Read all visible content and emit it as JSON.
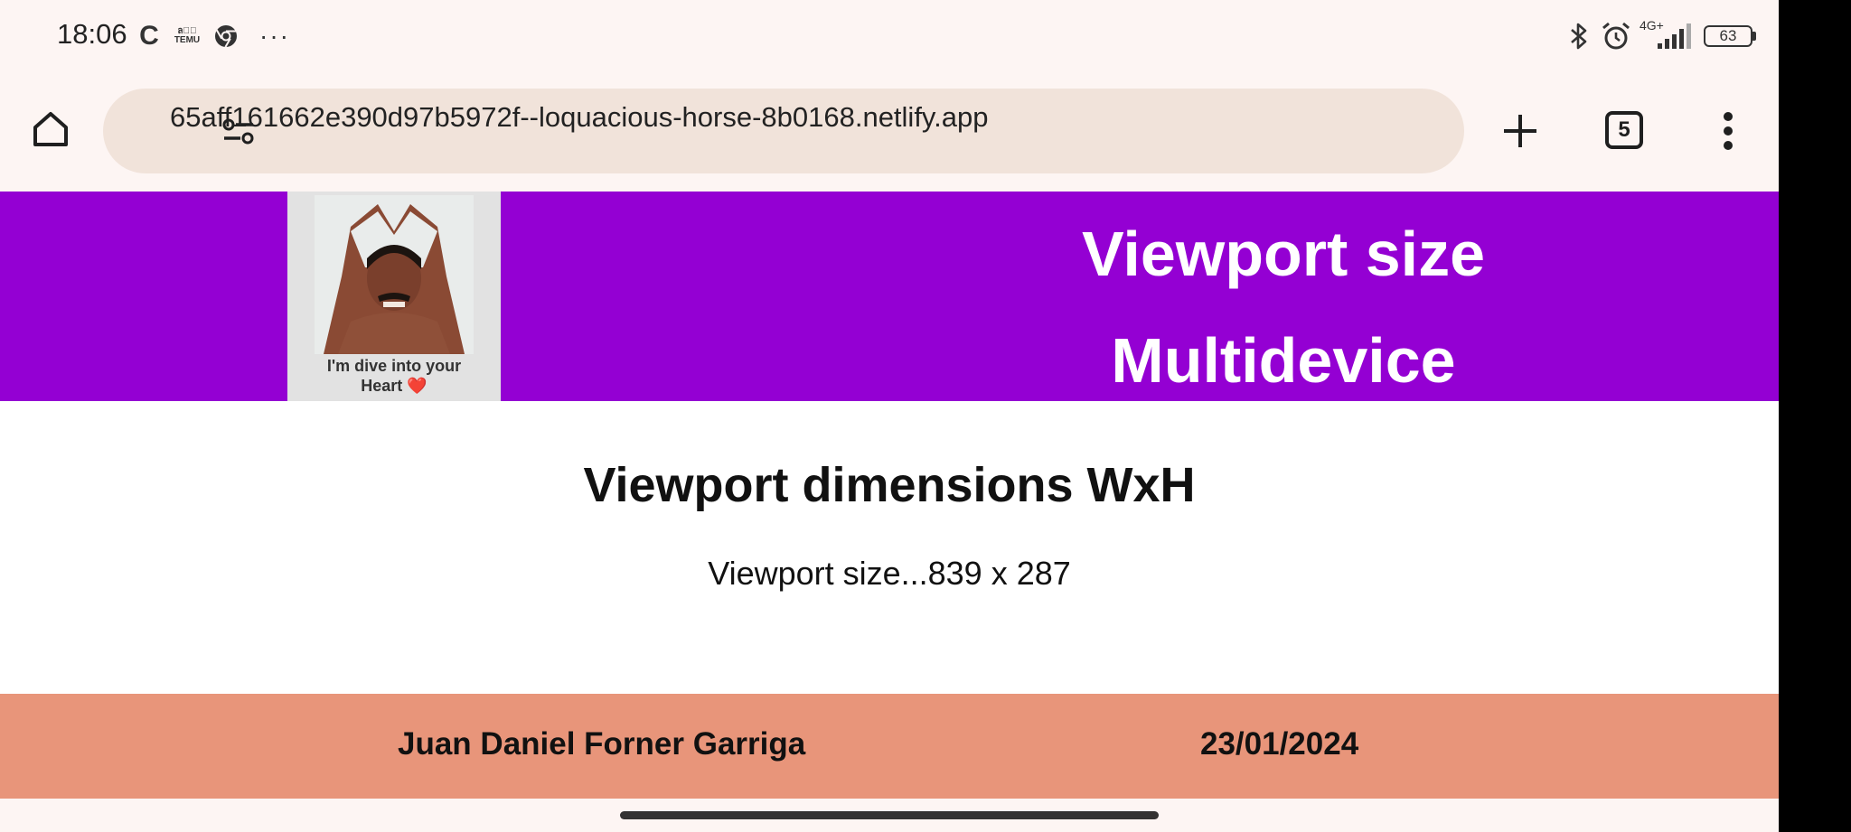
{
  "status_bar": {
    "time": "18:06",
    "c_icon_glyph": "C",
    "temu_top": "ล≋ํ",
    "temu_bottom": "TEMU",
    "more_dots": "···",
    "signal_label": "4G+",
    "battery_level": "63",
    "icons": [
      "c-icon",
      "temu-icon",
      "chrome-icon",
      "more-icon",
      "bluetooth-icon",
      "alarm-icon",
      "signal-icon",
      "battery-icon"
    ]
  },
  "browser": {
    "url": "65aff161662e390d97b5972f--loquacious-horse-8b0168.netlify.app",
    "tab_count": "5",
    "icons": [
      "home-icon",
      "site-settings-icon",
      "plus-icon",
      "tabs-icon",
      "more-vert-icon"
    ]
  },
  "page": {
    "logo_caption_line1": "I'm dive into your",
    "logo_caption_line2": "Heart ❤️",
    "header_title_line1": "Viewport size",
    "header_title_line2": "Multidevice",
    "heading": "Viewport dimensions WxH",
    "viewport_text": "Viewport size...839 x 287",
    "footer_author": "Juan Daniel Forner Garriga",
    "footer_date": "23/01/2024"
  },
  "colors": {
    "header_bg": "#9400d3",
    "footer_bg": "#e8957a",
    "toolbar_bg": "#fdf5f3",
    "url_bar_bg": "#f1e3da"
  }
}
